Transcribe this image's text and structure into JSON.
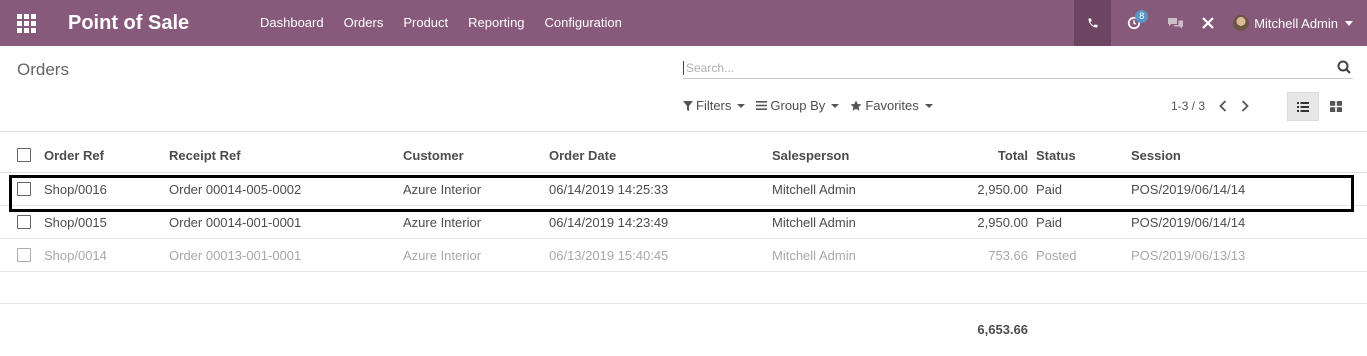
{
  "navbar": {
    "brand": "Point of Sale",
    "menu": [
      "Dashboard",
      "Orders",
      "Product",
      "Reporting",
      "Configuration"
    ],
    "activity_count": "8",
    "user_name": "Mitchell Admin",
    "color": "#875a7b"
  },
  "control_panel": {
    "title": "Orders",
    "search_placeholder": "Search...",
    "filters_label": "Filters",
    "group_by_label": "Group By",
    "favorites_label": "Favorites",
    "pager": "1-3 / 3"
  },
  "table": {
    "columns": [
      "Order Ref",
      "Receipt Ref",
      "Customer",
      "Order Date",
      "Salesperson",
      "Total",
      "Status",
      "Session"
    ],
    "rows": [
      [
        "Shop/0016",
        "Order 00014-005-0002",
        "Azure Interior",
        "06/14/2019 14:25:33",
        "Mitchell Admin",
        "2,950.00",
        "Paid",
        "POS/2019/06/14/14"
      ],
      [
        "Shop/0015",
        "Order 00014-001-0001",
        "Azure Interior",
        "06/14/2019 14:23:49",
        "Mitchell Admin",
        "2,950.00",
        "Paid",
        "POS/2019/06/14/14"
      ],
      [
        "Shop/0014",
        "Order 00013-001-0001",
        "Azure Interior",
        "06/13/2019 15:40:45",
        "Mitchell Admin",
        "753.66",
        "Posted",
        "POS/2019/06/13/13"
      ]
    ],
    "grand_total": "6,653.66"
  }
}
